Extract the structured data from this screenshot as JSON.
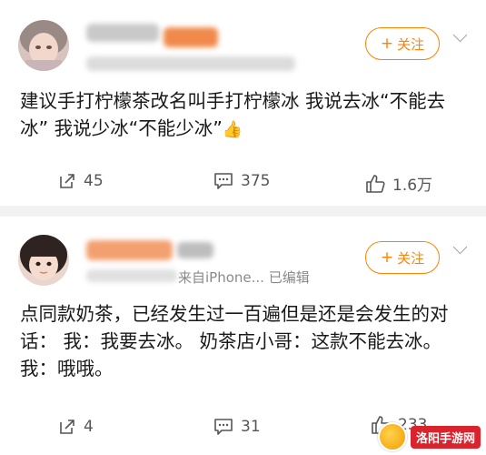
{
  "posts": [
    {
      "follow_label": "关注",
      "text": "建议手打柠檬茶改名叫手打柠檬冰 我说去冰“不能去冰” 我说少冰“不能少冰”",
      "emoji": "👍",
      "actions": {
        "share": "45",
        "comment": "375",
        "like": "1.6万"
      }
    },
    {
      "follow_label": "关注",
      "meta": "来自iPhone... 已编辑",
      "text": "点同款奶茶，已经发生过一百遍但是还是会发生的对话： 我：我要去冰。 奶茶店小哥：这款不能去冰。 我：哦哦。",
      "actions": {
        "share": "4",
        "comment": "31",
        "like": "233"
      }
    }
  ],
  "watermark": "洛阳手游网",
  "icons": {
    "plus": "plus-icon",
    "chevron": "chevron-down-icon",
    "share": "share-icon",
    "comment": "comment-icon",
    "like": "thumbs-up-icon"
  },
  "colors": {
    "accent": "#ff8200",
    "text": "#1a1a1a",
    "muted": "#555555"
  }
}
